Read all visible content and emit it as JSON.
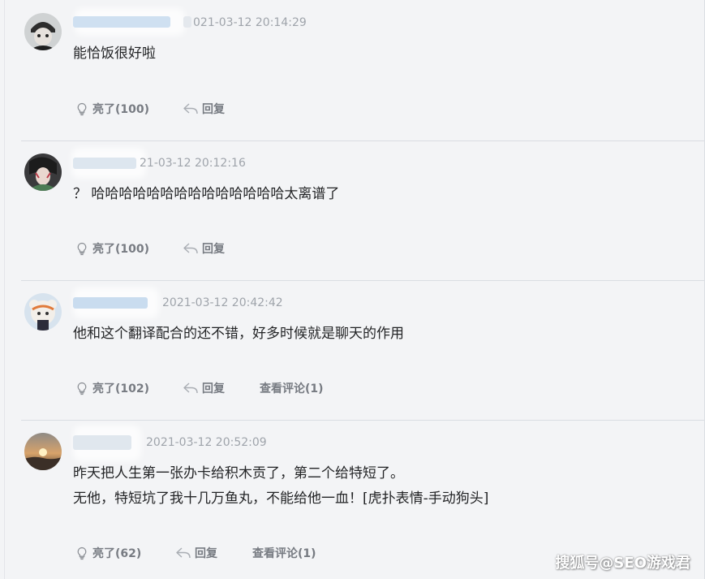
{
  "comments": [
    {
      "timestamp": "021-03-12 20:14:29",
      "content": [
        "能恰饭很好啦"
      ],
      "like_label": "亮了(100)",
      "reply_label": "回复",
      "view_label": ""
    },
    {
      "timestamp": "21-03-12 20:12:16",
      "content": [
        "？ 哈哈哈哈哈哈哈哈哈哈哈哈哈哈太离谱了"
      ],
      "like_label": "亮了(100)",
      "reply_label": "回复",
      "view_label": ""
    },
    {
      "timestamp": "2021-03-12 20:42:42",
      "content": [
        "他和这个翻译配合的还不错，好多时候就是聊天的作用"
      ],
      "like_label": "亮了(102)",
      "reply_label": "回复",
      "view_label": "查看评论(1)"
    },
    {
      "timestamp": "2021-03-12 20:52:09",
      "content": [
        "昨天把人生第一张办卡给积木贡了，第二个给特短了。",
        "无他，特短坑了我十几万鱼丸，不能给他一血！[虎扑表情-手动狗头]"
      ],
      "like_label": "亮了(62)",
      "reply_label": "回复",
      "view_label": "查看评论(1)"
    }
  ],
  "watermark": "搜狐号@SEO游戏君",
  "colors": {
    "background": "#f3f4f6",
    "text": "#232426",
    "muted": "#9fa4ab",
    "action": "#777b82"
  },
  "icons": {
    "like": "lightbulb-icon",
    "reply": "reply-arrow-icon"
  }
}
